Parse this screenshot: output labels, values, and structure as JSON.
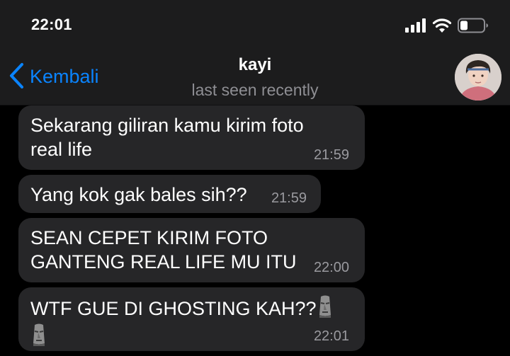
{
  "status_bar": {
    "time": "22:01",
    "icons": [
      "signal-bars-icon",
      "wifi-icon",
      "battery-icon"
    ]
  },
  "nav": {
    "back_label": "Kembali",
    "contact_name": "kayi",
    "contact_status": "last seen recently",
    "accent_color": "#0a84ff"
  },
  "messages": [
    {
      "text": "Sekarang giliran kamu kirim foto\nreal life",
      "time": "21:59"
    },
    {
      "text": "Yang kok gak bales sih??",
      "time": "21:59"
    },
    {
      "text": "SEAN CEPET KIRIM FOTO\nGANTENG REAL LIFE MU ITU",
      "time": "22:00"
    },
    {
      "text": "WTF GUE DI GHOSTING KAH??",
      "emoji": "moai-emoji",
      "time": "22:01"
    }
  ]
}
